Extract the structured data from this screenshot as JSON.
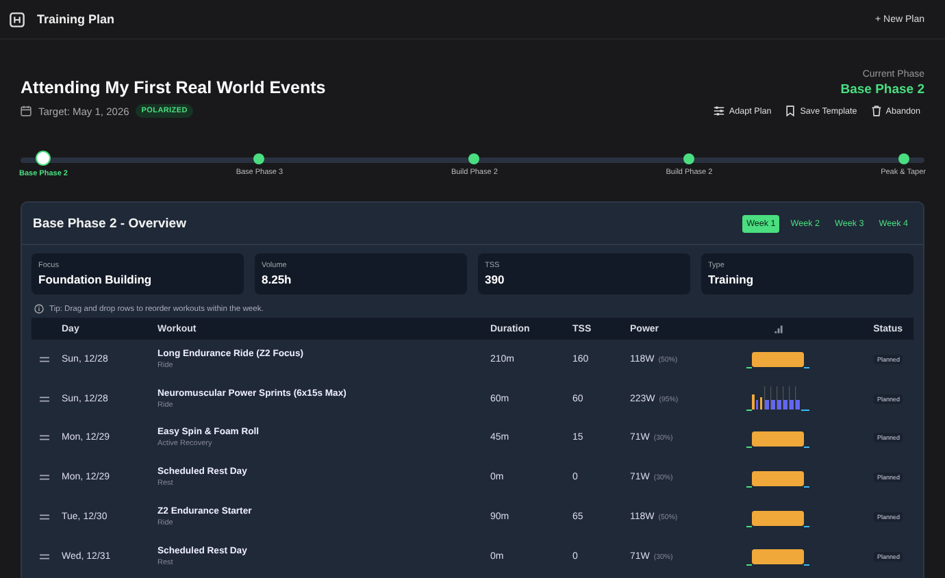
{
  "app_bar": {
    "title": "Training Plan",
    "new_button": "+ New Plan"
  },
  "plan": {
    "title": "Attending My First Real World Events",
    "target": "Target: May 1, 2026",
    "badge": "POLARIZED",
    "current_phase_label": "Current Phase",
    "current_phase": "Base Phase 2",
    "actions": [
      "Adapt Plan",
      "Save Template",
      "Abandon"
    ]
  },
  "phases": [
    {
      "label": "Base Phase 2",
      "selected": true
    },
    {
      "label": "Base Phase 3",
      "selected": false
    },
    {
      "label": "Build Phase 2",
      "selected": false
    },
    {
      "label": "Build Phase 2",
      "selected": false
    },
    {
      "label": "Peak & Taper",
      "selected": false
    }
  ],
  "overview": {
    "title": "Base Phase 2 - Overview",
    "weeks": [
      {
        "label": "Week 1",
        "selected": true
      },
      {
        "label": "Week 2",
        "selected": false
      },
      {
        "label": "Week 3",
        "selected": false
      },
      {
        "label": "Week 4",
        "selected": false
      }
    ],
    "stats": [
      {
        "label": "Focus",
        "value": "Foundation Building"
      },
      {
        "label": "Volume",
        "value": "8.25h"
      },
      {
        "label": "TSS",
        "value": "390"
      },
      {
        "label": "Type",
        "value": "Training"
      }
    ],
    "tip": "Tip: Drag and drop rows to reorder workouts within the week.",
    "columns": [
      "Day",
      "Workout",
      "Duration",
      "TSS",
      "Power",
      "Status"
    ],
    "rows": [
      {
        "day": "Sun, 12/28",
        "workout": "Long Endurance Ride (Z2 Focus)",
        "type": "Ride",
        "duration": "210m",
        "tss": "160",
        "power": "118W",
        "pct": "(50%)",
        "kind": "steady",
        "status": "Planned"
      },
      {
        "day": "Sun, 12/28",
        "workout": "Neuromuscular Power Sprints (6x15s Max)",
        "type": "Ride",
        "duration": "60m",
        "tss": "60",
        "power": "223W",
        "pct": "(95%)",
        "kind": "intervals",
        "status": "Planned"
      },
      {
        "day": "Mon, 12/29",
        "workout": "Easy Spin & Foam Roll",
        "type": "Active Recovery",
        "duration": "45m",
        "tss": "15",
        "power": "71W",
        "pct": "(30%)",
        "kind": "steady",
        "status": "Planned"
      },
      {
        "day": "Mon, 12/29",
        "workout": "Scheduled Rest Day",
        "type": "Rest",
        "duration": "0m",
        "tss": "0",
        "power": "71W",
        "pct": "(30%)",
        "kind": "steady",
        "status": "Planned"
      },
      {
        "day": "Tue, 12/30",
        "workout": "Z2 Endurance Starter",
        "type": "Ride",
        "duration": "90m",
        "tss": "65",
        "power": "118W",
        "pct": "(50%)",
        "kind": "steady",
        "status": "Planned"
      },
      {
        "day": "Wed, 12/31",
        "workout": "Scheduled Rest Day",
        "type": "Rest",
        "duration": "0m",
        "tss": "0",
        "power": "71W",
        "pct": "(30%)",
        "kind": "steady",
        "status": "Planned"
      }
    ]
  }
}
